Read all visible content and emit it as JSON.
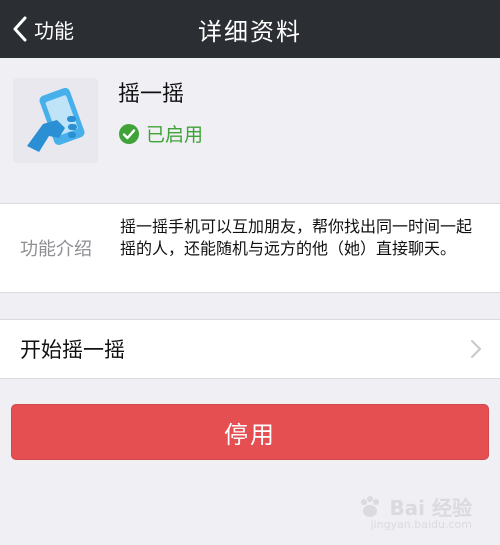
{
  "nav": {
    "back_label": "功能",
    "title": "详细资料"
  },
  "profile": {
    "app_name": "摇一摇",
    "status": "已启用",
    "status_color": "#40a33a"
  },
  "intro": {
    "label": "功能介绍",
    "description": "摇一摇手机可以互加朋友，帮你找出同一时间一起摇的人，还能随机与远方的他（她）直接聊天。"
  },
  "row": {
    "label": "开始摇一摇"
  },
  "actions": {
    "disable_label": "停用",
    "disable_color": "#e64f52"
  },
  "watermark": {
    "text": "Bai 经验",
    "sub": "jingyan.baidu.com"
  }
}
